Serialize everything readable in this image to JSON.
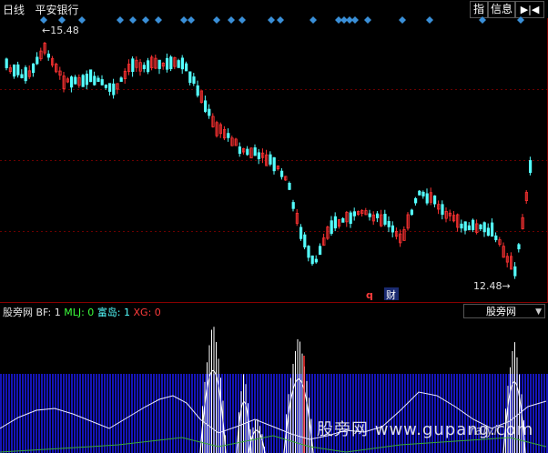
{
  "header": {
    "period": "日线",
    "stock_name": "平安银行",
    "btn_indicator": "指",
    "btn_info": "信息",
    "btn_nav": "▶|◀"
  },
  "main_chart": {
    "high_label": "←15.48",
    "low_label": "12.48→",
    "high_value": 15.48,
    "low_value": 12.48,
    "marker_q": "q",
    "marker_cai": "财"
  },
  "indicator": {
    "title_name": "股旁网",
    "bf_label": "BF: 1",
    "mlj_label": "MLJ: 0",
    "fudao_label": "富岛: 1",
    "xg_label": "XG: 0",
    "select_value": "股旁网"
  },
  "watermark": {
    "text": "股旁网 www.gupang.com",
    "sub": "raiyi"
  },
  "colors": {
    "up": "#ff3232",
    "down": "#54ffff",
    "grid": "#800000",
    "diamond": "#3a8fd8",
    "blue_fill": "#1515b8"
  }
}
